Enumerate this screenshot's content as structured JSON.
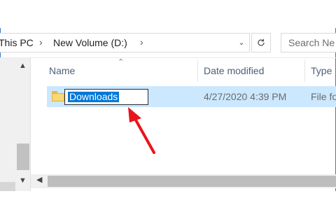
{
  "address": {
    "crumbs": [
      "This PC",
      "New Volume (D:)"
    ],
    "dropdown_icon": "chevron-down-icon",
    "refresh_icon": "refresh-icon"
  },
  "search": {
    "placeholder": "Search Ne"
  },
  "columns": {
    "name": "Name",
    "date_modified": "Date modified",
    "type": "Type"
  },
  "row": {
    "name": "Downloads",
    "date_modified": "4/27/2020 4:39 PM",
    "type": "File fo"
  },
  "colors": {
    "selection": "#cce8ff",
    "text_highlight": "#0078d7",
    "annotation_arrow": "#e8141b"
  }
}
